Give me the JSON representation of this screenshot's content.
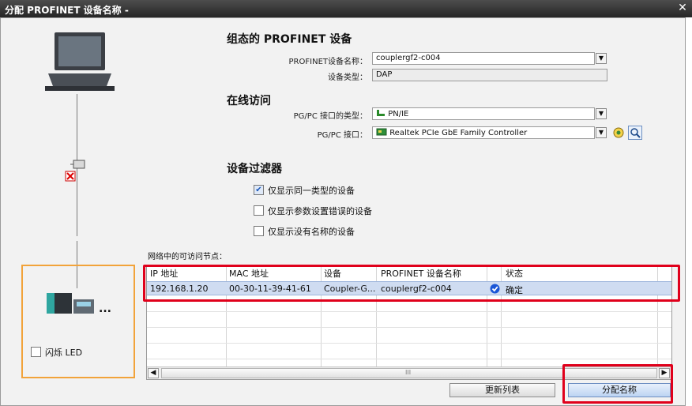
{
  "window": {
    "title": "分配 PROFINET 设备名称 -",
    "close_symbol": "✕"
  },
  "configured_device": {
    "section_title": "组态的 PROFINET 设备",
    "name_label": "PROFINET设备名称：",
    "name_value": "couplergf2-c004",
    "type_label": "设备类型：",
    "type_value": "DAP"
  },
  "online_access": {
    "section_title": "在线访问",
    "interface_type_label": "PG/PC 接口的类型：",
    "interface_type_value": "PN/IE",
    "interface_label": "PG/PC 接口：",
    "interface_value": "Realtek PCIe GbE Family Controller"
  },
  "device_filter": {
    "section_title": "设备过滤器",
    "options": [
      {
        "label": "仅显示同一类型的设备",
        "checked": true
      },
      {
        "label": "仅显示参数设置错误的设备",
        "checked": false
      },
      {
        "label": "仅显示没有名称的设备",
        "checked": false
      }
    ]
  },
  "accessible_nodes": {
    "label": "网络中的可访问节点：",
    "columns": [
      "IP 地址",
      "MAC 地址",
      "设备",
      "PROFINET 设备名称",
      "状态"
    ],
    "rows": [
      {
        "ip": "192.168.1.20",
        "mac": "00-30-11-39-41-61",
        "device": "Coupler-G...",
        "name": "couplergf2-c004",
        "status": "确定"
      }
    ],
    "scroll_center_mark": "III"
  },
  "left_panel": {
    "flash_led_label": "闪烁 LED",
    "flash_led_checked": false,
    "device_ellipsis": "..."
  },
  "buttons": {
    "refresh_list": "更新列表",
    "assign_name": "分配名称"
  },
  "colors": {
    "highlight_red": "#e0001b",
    "highlight_orange": "#f2a33a",
    "selected_row": "#cfdcf1",
    "ok_icon": "#1a56d6"
  }
}
